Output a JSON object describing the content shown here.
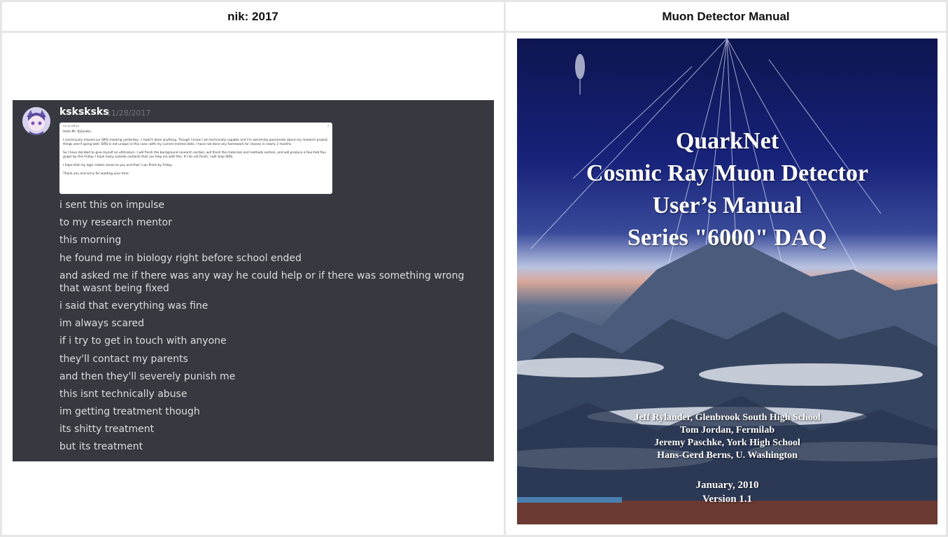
{
  "headers": {
    "left": "nik: 2017",
    "right": "Muon Detector Manual"
  },
  "discord": {
    "username": "ksksksks",
    "timestamp": "11/28/2017",
    "embed": {
      "from_line": "me to Jeffrey",
      "greeting": "Hello Mr. Rylander,",
      "para1": "I consciously missed our SIRS meeting yesterday - I hadn't done anything. Though I know I am technically capable and I'm extremely passionate about my research project, things aren't going well. SIRS is not unique in this case: with my current mental state, I have not done any homework for classes in nearly 2 months.",
      "para2": "So I have decided to give myself an ultimatum. I will finish the background research section, will finish the materials and methods section, and will produce a four-fold flux graph by this Friday. I have many outside contacts that can help me with this. If I do not finish, I will drop SIRS.",
      "para3": "I hope that my logic makes sense to you and that I can finish by Friday.",
      "para4": "Thank you and sorry for wasting your time."
    },
    "messages": [
      "i sent this on impulse",
      "to my research mentor",
      "this morning",
      "he found me in biology right before school ended",
      "and asked me if there was any way he could help or if there was something wrong that wasnt being fixed",
      "i said that everything was fine",
      "im always scared",
      "if i try to get in touch with anyone",
      "they'll contact my parents",
      "and then they'll severely punish me",
      "this isnt technically abuse",
      "im getting treatment though",
      "its shitty treatment",
      "but its treatment"
    ]
  },
  "cover": {
    "title_lines": [
      "QuarkNet",
      "Cosmic Ray Muon Detector",
      "User’s Manual",
      "Series \"6000\" DAQ"
    ],
    "authors": [
      "Jeff Rylander, Glenbrook South High School",
      "Tom Jordan, Fermilab",
      "Jeremy  Paschke, York High School",
      "Hans-Gerd Berns, U. Washington"
    ],
    "date": "January, 2010",
    "version": "Version 1.1"
  }
}
